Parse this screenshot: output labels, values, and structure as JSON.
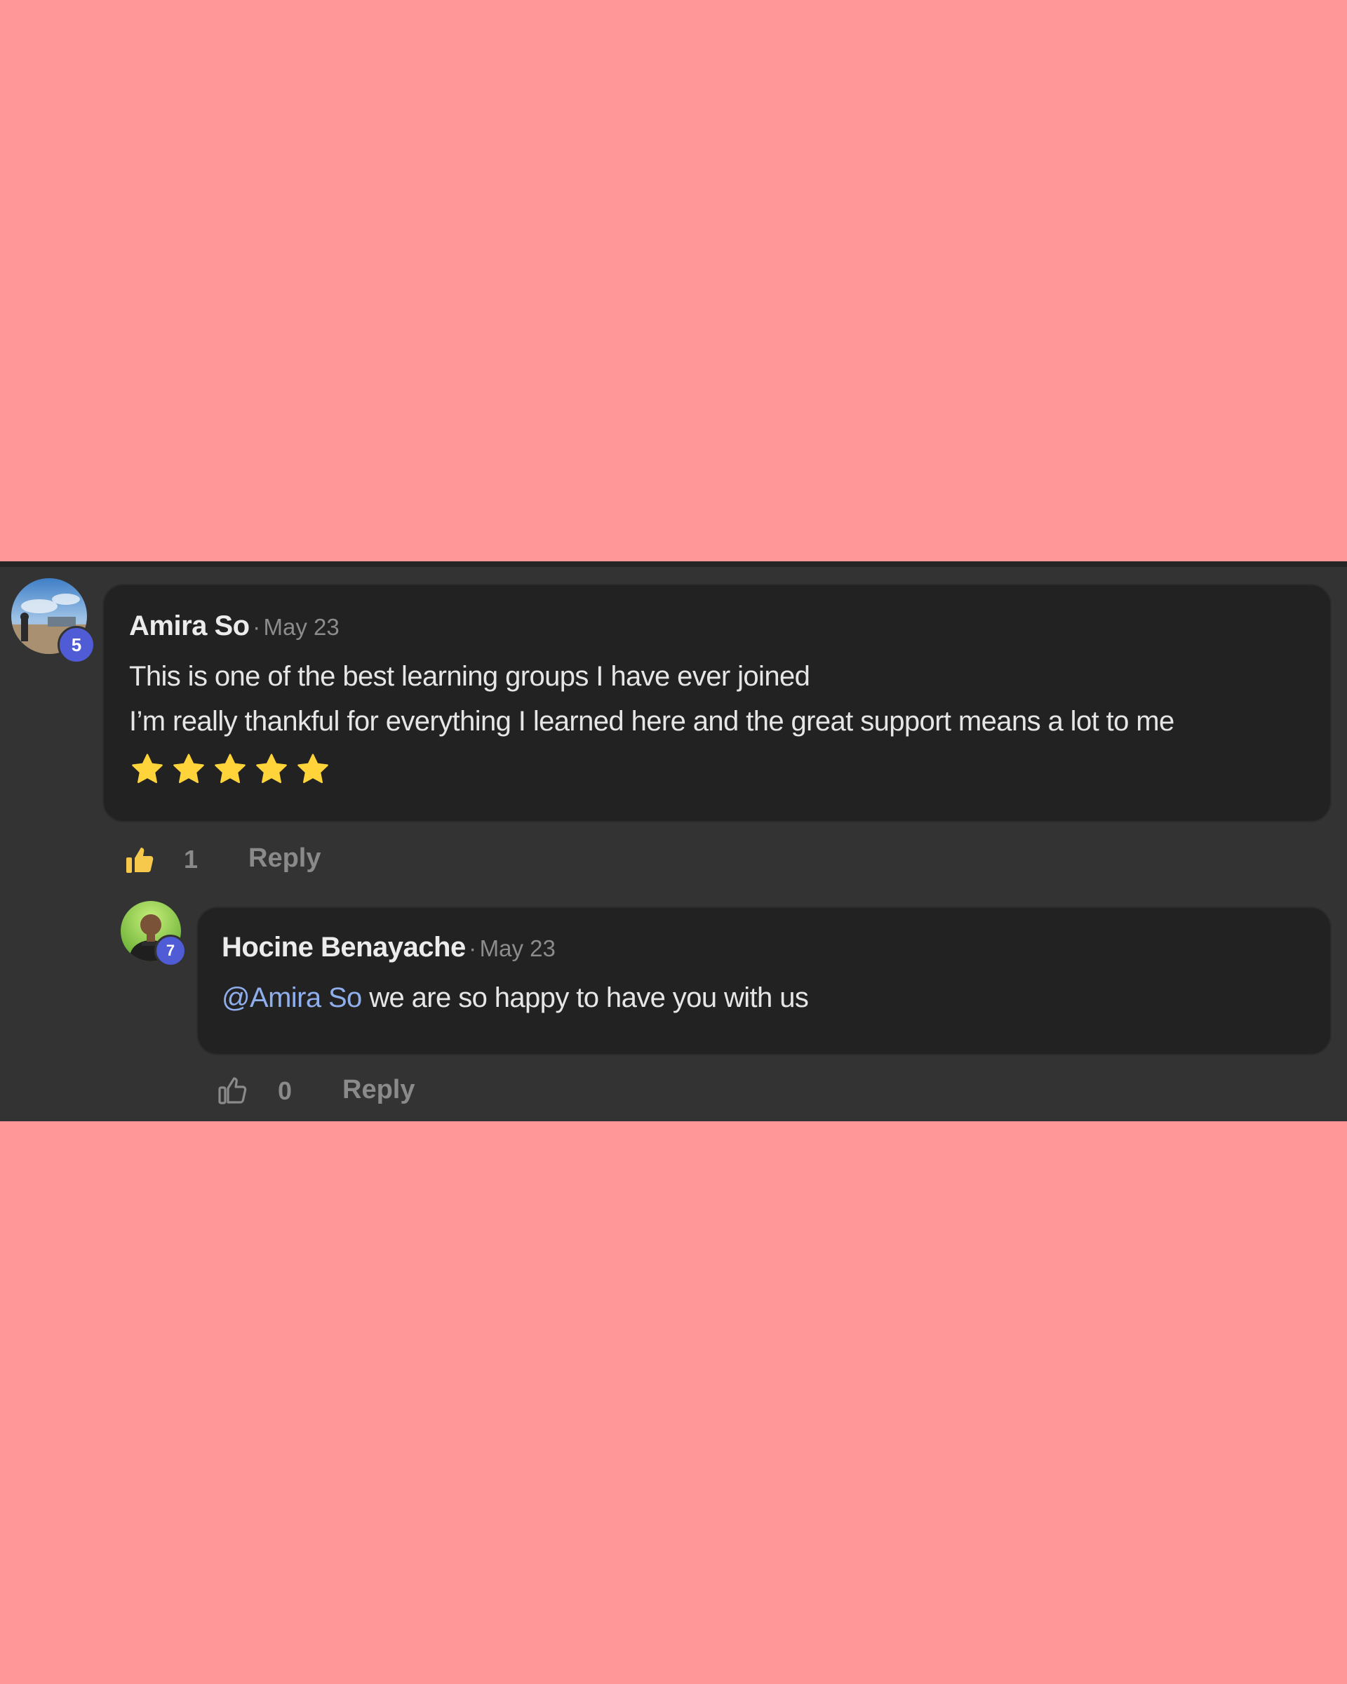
{
  "comments": [
    {
      "author": "Amira So",
      "separator": "·",
      "date": "May 23",
      "level": "5",
      "lines": [
        "This is one of the best learning groups I have ever joined",
        "I’m really thankful for everything I learned here and the great support means a lot to me"
      ],
      "rating_stars": 5,
      "likes": "1",
      "liked": true,
      "reply_label": "Reply"
    },
    {
      "author": "Hocine Benayache",
      "separator": "·",
      "date": "May 23",
      "level": "7",
      "mention": "@Amira So",
      "text": " we are so happy to have you with us",
      "likes": "0",
      "liked": false,
      "reply_label": "Reply"
    }
  ],
  "colors": {
    "page_background": "#ff9798",
    "thread_background": "#333333",
    "bubble_background": "#222222",
    "level_badge": "#4f5cd6",
    "mention": "#8faeec",
    "star": "#ffd43b",
    "liked_thumb": "#f6c94d"
  },
  "icons": {
    "star": "star-icon",
    "liked": "thumbs-up-filled-icon",
    "like": "thumbs-up-outline-icon"
  }
}
